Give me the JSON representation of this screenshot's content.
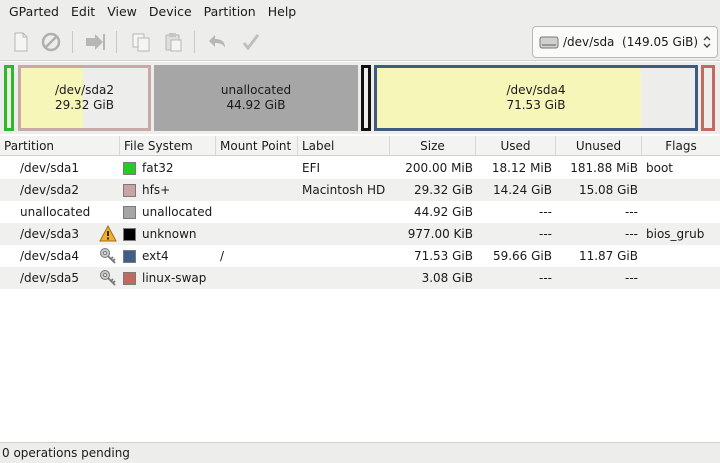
{
  "menu": [
    "GParted",
    "Edit",
    "View",
    "Device",
    "Partition",
    "Help"
  ],
  "toolbar": {
    "icons": [
      "new-partition-icon",
      "delete-icon",
      "resize-move-icon",
      "copy-icon",
      "paste-icon",
      "undo-icon",
      "apply-icon"
    ]
  },
  "device_selector": {
    "value": "/dev/sda  (149.05 GiB)"
  },
  "graph": {
    "segments": [
      {
        "name": "/dev/sda1",
        "label": "",
        "size": "",
        "used_fraction": 0.09,
        "border_color": "#2fb82f"
      },
      {
        "name": "/dev/sda2",
        "label": "/dev/sda2",
        "size": "29.32 GiB",
        "used_fraction": 0.49,
        "border_color": "#c9a8a8"
      },
      {
        "name": "unallocated",
        "label": "unallocated",
        "size": "44.92 GiB",
        "used_fraction": 0,
        "border_color": "#a6a6a6"
      },
      {
        "name": "/dev/sda3",
        "label": "",
        "size": "",
        "used_fraction": 0,
        "border_color": "#111111"
      },
      {
        "name": "/dev/sda4",
        "label": "/dev/sda4",
        "size": "71.53 GiB",
        "used_fraction": 0.83,
        "border_color": "#3e5c82"
      },
      {
        "name": "/dev/sda5",
        "label": "",
        "size": "",
        "used_fraction": 0,
        "border_color": "#c06a60"
      }
    ]
  },
  "columns": [
    "Partition",
    "File System",
    "Mount Point",
    "Label",
    "Size",
    "Used",
    "Unused",
    "Flags"
  ],
  "rows": [
    {
      "partition": "/dev/sda1",
      "icon": "",
      "fs": "fat32",
      "fs_color": "#22cc22",
      "mount": "",
      "label": "EFI",
      "size": "200.00 MiB",
      "used": "18.12 MiB",
      "unused": "181.88 MiB",
      "flags": "boot"
    },
    {
      "partition": "/dev/sda2",
      "icon": "",
      "fs": "hfs+",
      "fs_color": "#c8a4a4",
      "mount": "",
      "label": "Macintosh HD",
      "size": "29.32 GiB",
      "used": "14.24 GiB",
      "unused": "15.08 GiB",
      "flags": ""
    },
    {
      "partition": "unallocated",
      "icon": "",
      "fs": "unallocated",
      "fs_color": "#a6a6a6",
      "mount": "",
      "label": "",
      "size": "44.92 GiB",
      "used": "---",
      "unused": "---",
      "flags": ""
    },
    {
      "partition": "/dev/sda3",
      "icon": "warning-icon",
      "fs": "unknown",
      "fs_color": "#000000",
      "mount": "",
      "label": "",
      "size": "977.00 KiB",
      "used": "---",
      "unused": "---",
      "flags": "bios_grub"
    },
    {
      "partition": "/dev/sda4",
      "icon": "key-icon",
      "fs": "ext4",
      "fs_color": "#3f5f86",
      "mount": "/",
      "label": "",
      "size": "71.53 GiB",
      "used": "59.66 GiB",
      "unused": "11.87 GiB",
      "flags": ""
    },
    {
      "partition": "/dev/sda5",
      "icon": "key-icon",
      "fs": "linux-swap",
      "fs_color": "#c2685e",
      "mount": "",
      "label": "",
      "size": "3.08 GiB",
      "used": "---",
      "unused": "---",
      "flags": ""
    }
  ],
  "status": "0 operations pending"
}
